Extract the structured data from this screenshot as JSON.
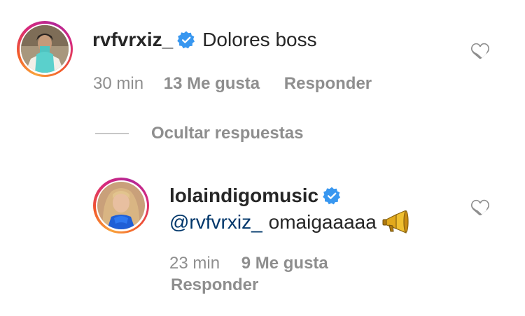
{
  "comments": [
    {
      "username": "rvfvrxiz_",
      "verified": true,
      "text": "Dolores boss",
      "time": "30 min",
      "likes": "13 Me gusta",
      "reply_label": "Responder"
    }
  ],
  "replies_toggle": {
    "label": "Ocultar respuestas"
  },
  "replies": [
    {
      "username": "lolaindigomusic",
      "verified": true,
      "mention": "@rvfvrxiz_",
      "text": "omaigaaaaa",
      "emoji": "📢",
      "time": "23 min",
      "likes": "9 Me gusta",
      "reply_label": "Responder"
    }
  ],
  "icons": {
    "verified": "verified-badge-icon",
    "like": "heart-outline-icon",
    "emoji": "megaphone-emoji-icon"
  },
  "colors": {
    "verified_blue": "#3897f0",
    "mention": "#00376b",
    "secondary_text": "#8e8e8e"
  }
}
